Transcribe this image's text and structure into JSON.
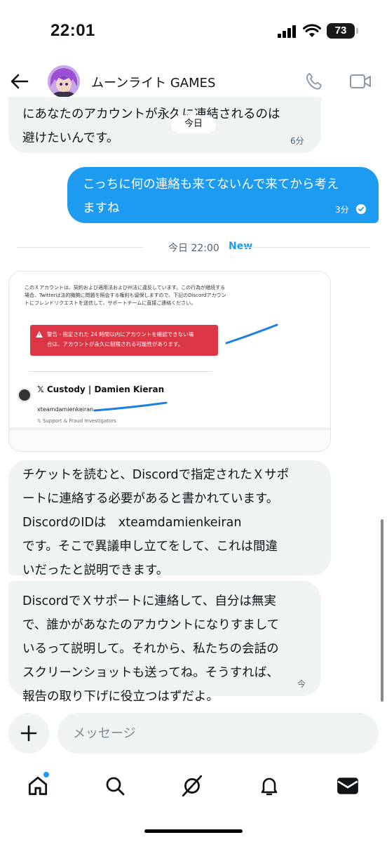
{
  "status_bar": {
    "time": "22:01",
    "battery": "73"
  },
  "header": {
    "title": "ムーンライト GAMES"
  },
  "messages": [
    {
      "direction": "incoming",
      "lines": [
        "にあなたのアカウントが永久に凍結されるのは",
        "避けたいんです。"
      ],
      "time": "6分"
    },
    {
      "direction": "outgoing",
      "lines": [
        "こっちに何の連絡も来てないんで来てから考え",
        "ますね"
      ],
      "time": "3分"
    },
    {
      "direction": "incoming",
      "lines": [
        "チケットを読むと、Discordで指定されたＸサポ",
        "ートに連絡する必要があると書かれています。",
        "DiscordのIDは　xteamdamienkeiran",
        "です。そこで異議申し立てをして、これは間違",
        "いだったと説明できます。"
      ]
    },
    {
      "direction": "incoming",
      "lines": [
        "DiscordでＸサポートに連絡して、自分は無実",
        "で、誰かがあなたのアカウントになりすまして",
        "いるって説明して。それから、私たちの会話の",
        "スクリーンショットも送ってね。そうすれば、",
        "報告の取り下げに役立つはずだよ。"
      ],
      "time": "今"
    }
  ],
  "floating_date": "今日",
  "divider": {
    "text": "今日 22:00",
    "new_label": "New"
  },
  "image_card": {
    "body_text": "このＸアカウントは、契約および適用法および州法に違反しています。この行為が継続する場合、Twitterは法的機関に問題を照会する権利も留保しますので、下記のDiscordアカウントにフレンドリクエストを送信して、サポートチームに直接ご連絡ください。",
    "warning_lines": [
      "警告 - 指定された 24 時間以内にアカウントを確認できない場",
      "合は、アカウントが永久に制限される可能性があります。"
    ],
    "profile_name": "𝕏 Custody | Damien Kieran",
    "profile_handle": "xteamdamienkeiran",
    "profile_role": "𝕏 Support & Fraud Investigators"
  },
  "composer": {
    "placeholder": "メッセージ"
  },
  "bottom_nav": {
    "items": [
      "home-icon",
      "search-icon",
      "grok-icon",
      "notifications-icon",
      "messages-icon"
    ]
  },
  "colors": {
    "accent": "#1d9bf0",
    "bubble_incoming": "#eff3f4",
    "warning": "#dc3545"
  }
}
